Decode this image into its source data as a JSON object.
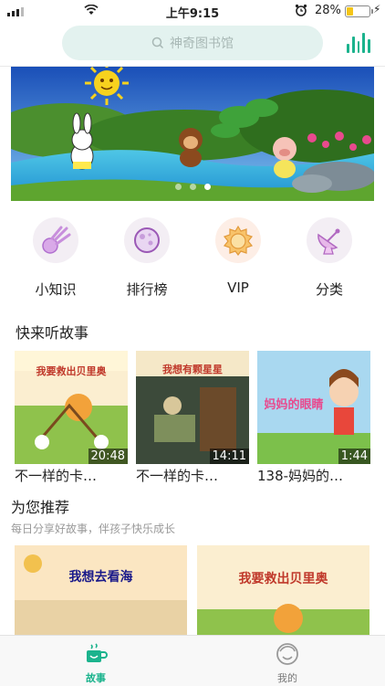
{
  "status": {
    "time": "上午9:15",
    "battery": "28%",
    "battery_level": 0.28
  },
  "search": {
    "placeholder": "神奇图书馆"
  },
  "banner": {
    "page_count": 3,
    "active_page": 3
  },
  "categories": [
    {
      "label": "小知识",
      "icon": "comet-icon"
    },
    {
      "label": "排行榜",
      "icon": "moon-icon"
    },
    {
      "label": "VIP",
      "icon": "sun-icon"
    },
    {
      "label": "分类",
      "icon": "satellite-dish-icon"
    }
  ],
  "listen": {
    "title": "快来听故事",
    "items": [
      {
        "caption": "不一样的卡…",
        "duration": "20:48",
        "cover_title": "我要救出贝里奥"
      },
      {
        "caption": "不一样的卡…",
        "duration": "14:11",
        "cover_title": "我想有颗星星"
      },
      {
        "caption": "138-妈妈的…",
        "duration": "1:44",
        "cover_title": "妈妈的眼睛"
      }
    ]
  },
  "recommend": {
    "title": "为您推荐",
    "subtitle": "每日分享好故事，伴孩子快乐成长",
    "items": [
      {
        "cover_title": "我想去看海"
      },
      {
        "cover_title": "我要救出贝里奥"
      }
    ]
  },
  "tabs": [
    {
      "label": "故事",
      "active": true,
      "icon": "cup-icon"
    },
    {
      "label": "我的",
      "active": false,
      "icon": "face-icon"
    }
  ],
  "colors": {
    "accent": "#1bb38d",
    "search_bg": "#e3f2ef"
  }
}
